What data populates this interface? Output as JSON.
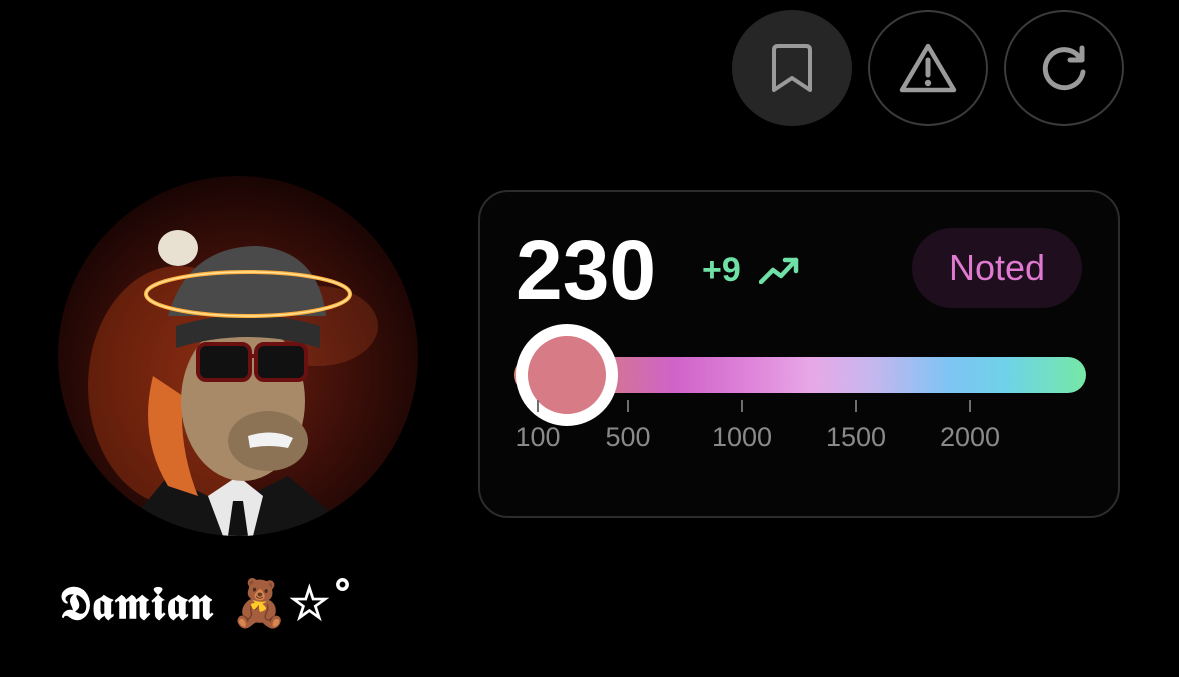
{
  "actions": [
    {
      "name": "bookmark-button",
      "icon": "bookmark-icon"
    },
    {
      "name": "report-button",
      "icon": "warning-triangle-icon"
    },
    {
      "name": "refresh-button",
      "icon": "refresh-icon"
    }
  ],
  "profile": {
    "display_name": "𝕯𝖆𝖒𝖎𝖆𝖓 🧸☆˚",
    "avatar": "ape-with-halo-avatar"
  },
  "rating": {
    "score": "230",
    "delta": "+9",
    "trend_icon": "trending-up-icon",
    "badge": "Noted",
    "slider_value": 230,
    "ticks": [
      {
        "value": 100,
        "label": "100"
      },
      {
        "value": 500,
        "label": "500"
      },
      {
        "value": 1000,
        "label": "1000"
      },
      {
        "value": 1500,
        "label": "1500"
      },
      {
        "value": 2000,
        "label": "2000"
      }
    ]
  },
  "colors": {
    "accent_green": "#6fe0a6",
    "badge_pink": "#e07ad0",
    "thumb": "#d77b86"
  }
}
